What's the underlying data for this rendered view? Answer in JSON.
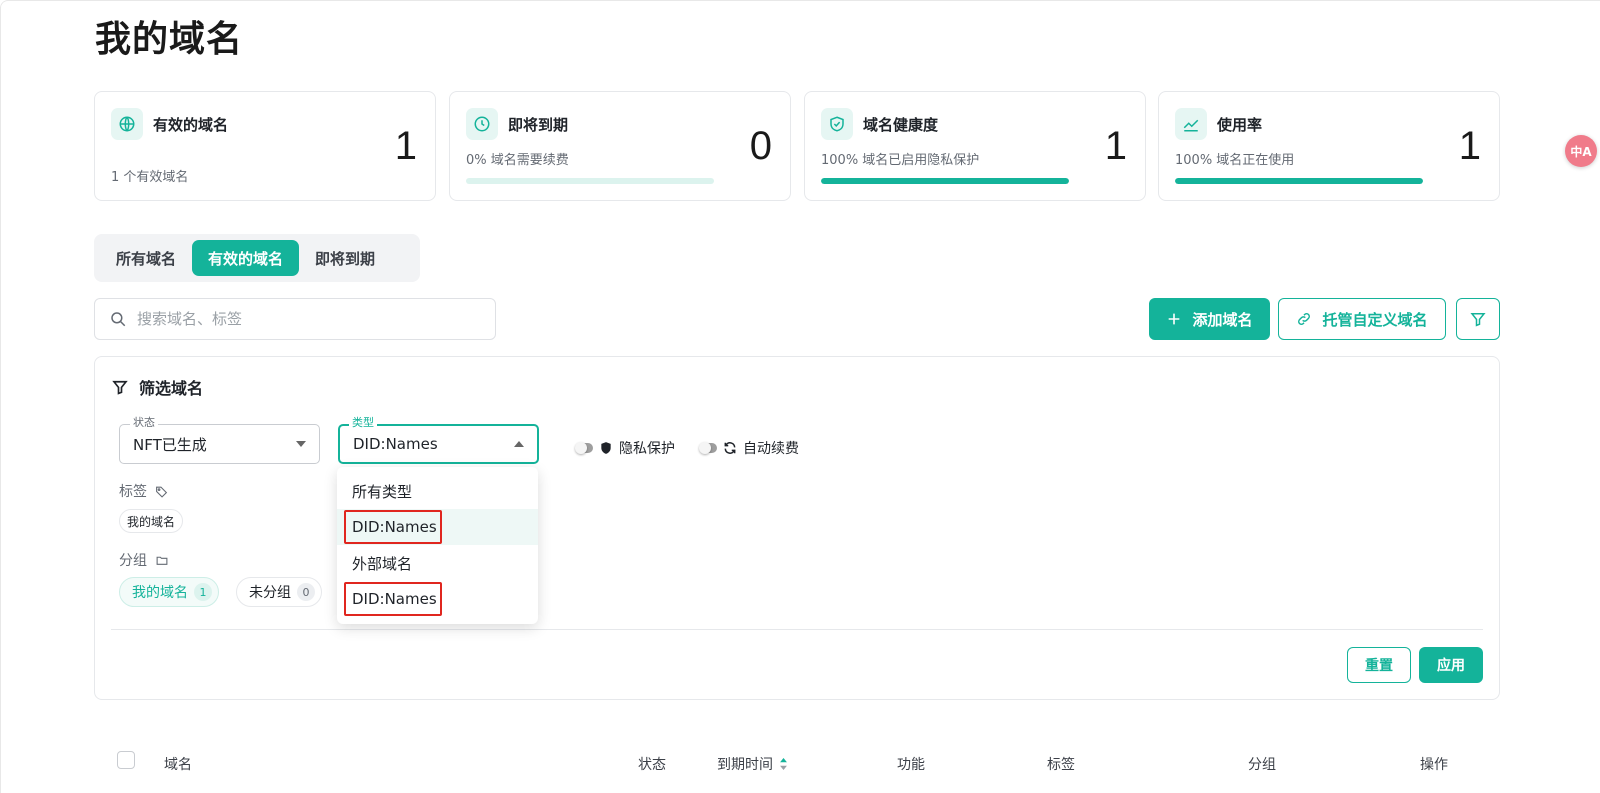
{
  "page": {
    "title": "我的域名"
  },
  "stats": [
    {
      "title": "有效的域名",
      "subtitle": "1 个有效域名",
      "value": "1",
      "icon": "globe-icon"
    },
    {
      "title": "即将到期",
      "subtitle": "0% 域名需要续费",
      "value": "0",
      "progress": 0,
      "icon": "clock-icon"
    },
    {
      "title": "域名健康度",
      "subtitle": "100% 域名已启用隐私保护",
      "value": "1",
      "progress": 100,
      "icon": "shield-check-icon"
    },
    {
      "title": "使用率",
      "subtitle": "100% 域名正在使用",
      "value": "1",
      "progress": 100,
      "icon": "chart-line-icon"
    }
  ],
  "tabs": [
    {
      "label": "所有域名",
      "active": false
    },
    {
      "label": "有效的域名",
      "active": true
    },
    {
      "label": "即将到期",
      "active": false
    }
  ],
  "search": {
    "placeholder": "搜索域名、标签"
  },
  "actions": {
    "add_domain": "添加域名",
    "host_custom": "托管自定义域名"
  },
  "filter": {
    "title": "筛选域名",
    "status": {
      "label": "状态",
      "value": "NFT已生成"
    },
    "type": {
      "label": "类型",
      "value": "DID:Names",
      "options": [
        "所有类型",
        "DID:Names",
        "外部域名",
        "DID:Names"
      ]
    },
    "toggles": {
      "privacy": "隐私保护",
      "auto_renew": "自动续费"
    },
    "tags": {
      "label": "标签",
      "items": [
        "我的域名"
      ]
    },
    "groups": {
      "label": "分组",
      "items": [
        {
          "name": "我的域名",
          "count": "1",
          "active": true
        },
        {
          "name": "未分组",
          "count": "0",
          "active": false
        }
      ]
    },
    "reset": "重置",
    "apply": "应用"
  },
  "table": {
    "columns": {
      "domain": "域名",
      "status": "状态",
      "expiry": "到期时间",
      "features": "功能",
      "tags": "标签",
      "group": "分组",
      "actions": "操作"
    }
  },
  "colors": {
    "accent": "#14b39a",
    "highlight_border": "#e0261f"
  },
  "translate_fab": {
    "label": "中A"
  }
}
